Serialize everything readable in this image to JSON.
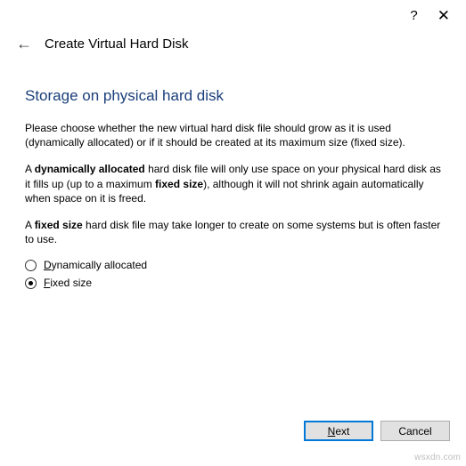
{
  "titlebar": {
    "help_glyph": "?",
    "close_glyph": "✕"
  },
  "header": {
    "back_glyph": "←",
    "title": "Create Virtual Hard Disk"
  },
  "section_title": "Storage on physical hard disk",
  "paragraphs": {
    "p1": "Please choose whether the new virtual hard disk file should grow as it is used (dynamically allocated) or if it should be created at its maximum size (fixed size).",
    "p2_a": "A ",
    "p2_b": "dynamically allocated",
    "p2_c": " hard disk file will only use space on your physical hard disk as it fills up (up to a maximum ",
    "p2_d": "fixed size",
    "p2_e": "), although it will not shrink again automatically when space on it is freed.",
    "p3_a": "A ",
    "p3_b": "fixed size",
    "p3_c": " hard disk file may take longer to create on some systems but is often faster to use."
  },
  "options": {
    "dyn_u": "D",
    "dyn_rest": "ynamically allocated",
    "fixed_u": "F",
    "fixed_rest": "ixed size"
  },
  "buttons": {
    "next_u": "N",
    "next_rest": "ext",
    "cancel": "Cancel"
  },
  "watermark": "wsxdn.com"
}
